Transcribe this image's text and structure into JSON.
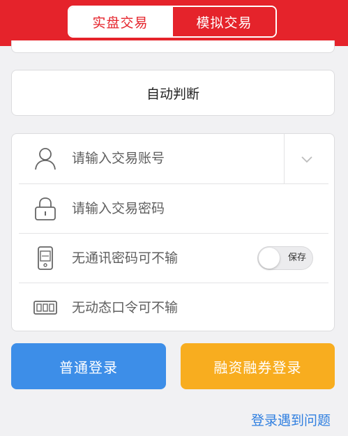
{
  "header": {
    "tabs": [
      {
        "label": "实盘交易",
        "active": true
      },
      {
        "label": "模拟交易",
        "active": false
      }
    ],
    "accent_color": "#e5232b"
  },
  "broker": {
    "value": "自动判断"
  },
  "form": {
    "account": {
      "placeholder": "请输入交易账号",
      "icon": "user-icon",
      "dropdown_icon": "chevron-down-icon"
    },
    "password": {
      "placeholder": "请输入交易密码",
      "icon": "lock-icon"
    },
    "comm_password": {
      "placeholder": "无通讯密码可不输",
      "icon": "phone-icon",
      "toggle_label": "保存",
      "toggle_on": false
    },
    "otp": {
      "placeholder": "无动态口令可不输",
      "icon": "token-icon"
    }
  },
  "buttons": {
    "normal_login": "普通登录",
    "margin_login": "融资融券登录",
    "normal_color": "#3d8ee8",
    "margin_color": "#f8ad1f"
  },
  "help_link": "登录遇到问题"
}
